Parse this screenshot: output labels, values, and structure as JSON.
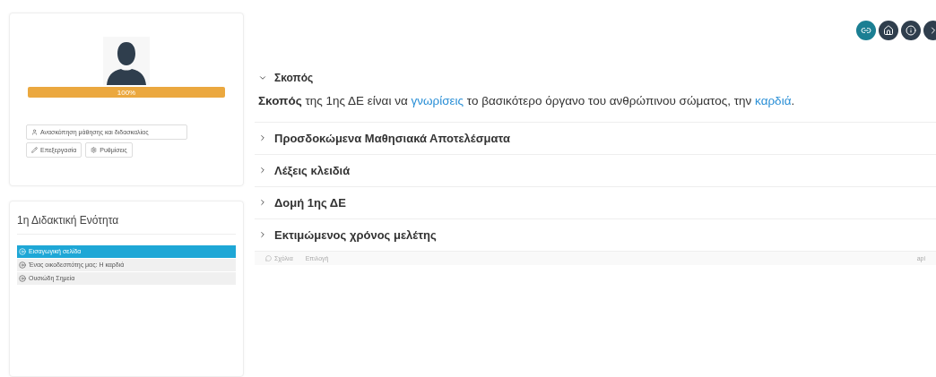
{
  "profile": {
    "progress": {
      "level": 1,
      "label": "100%"
    },
    "actions": [
      {
        "kind": "profile",
        "label": "Ανασκόπηση μάθησης και διδασκαλίας"
      },
      {
        "kind": "edit",
        "label": "Επεξεργασία"
      },
      {
        "kind": "settings",
        "label": "Ρυθμίσεις"
      }
    ]
  },
  "unit": {
    "title": "1η Διδακτική Ενότητα",
    "items": [
      {
        "label": "Εισαγωγική σελίδα",
        "selected": true
      },
      {
        "label": "Ένας οικοδεσπότης μας: Η καρδιά",
        "selected": false
      },
      {
        "label": "Ουσιώδη Σημεία",
        "selected": false
      }
    ]
  },
  "toolbar": [
    {
      "kind": "link",
      "selected": true
    },
    {
      "kind": "home",
      "selected": false
    },
    {
      "kind": "info",
      "selected": false
    },
    {
      "kind": "next",
      "selected": false
    }
  ],
  "sections": [
    {
      "title": "Σκοπός",
      "expanded": true,
      "body": [
        {
          "kind": "bold",
          "text": "Σκοπός"
        },
        {
          "kind": "plain",
          "text": " της 1ης ΔΕ είναι να "
        },
        {
          "kind": "link",
          "text": "γνωρίσεις"
        },
        {
          "kind": "plain",
          "text": " το βασικότερο όργανο του ανθρώπινου σώματος, την "
        },
        {
          "kind": "link",
          "text": "καρδιά"
        },
        {
          "kind": "plain",
          "text": "."
        }
      ]
    },
    {
      "title": "Προσδοκώμενα Μαθησιακά Αποτελέσματα",
      "expanded": false
    },
    {
      "title": "Λέξεις κλειδιά",
      "expanded": false
    },
    {
      "title": "Δομή 1ης ΔΕ",
      "expanded": false
    },
    {
      "title": "Εκτιμώμενος χρόνος μελέτης",
      "expanded": false
    }
  ],
  "footer": {
    "left": [
      "Σχόλια",
      "Επιλογή"
    ],
    "right": "api"
  }
}
